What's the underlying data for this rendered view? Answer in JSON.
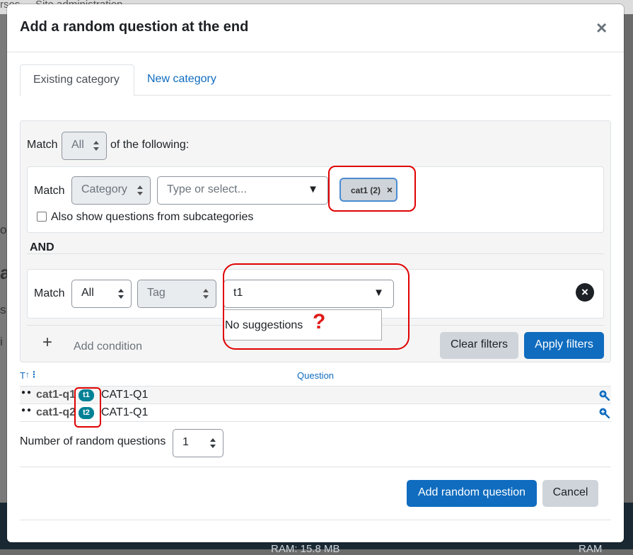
{
  "background": {
    "topbar_left": "rses",
    "topbar_nav": "Site administration",
    "left_fragments": [
      "o",
      "a",
      "s",
      "i"
    ],
    "bottom_left": "RAM: 15.8 MB",
    "bottom_right": "RAM"
  },
  "modal": {
    "title": "Add a random question at the end",
    "close_symbol": "×"
  },
  "tabs": [
    {
      "label": "Existing category",
      "active": true
    },
    {
      "label": "New category",
      "active": false
    }
  ],
  "filter": {
    "match_label": "Match",
    "match_value": "All",
    "of_following": "of the following:",
    "condition1": {
      "match_label": "Match",
      "type_value": "Category",
      "input_placeholder": "Type or select...",
      "chip_label": "cat1 (2)",
      "chip_remove": "×",
      "subcat_label": "Also show questions from subcategories"
    },
    "and_label": "AND",
    "condition2": {
      "match_label": "Match",
      "match_value": "All",
      "type_value": "Tag",
      "input_value": "t1",
      "no_suggestions": "No suggestions",
      "question_mark": "?",
      "remove_symbol": "×"
    },
    "add_condition_symbol": "+",
    "add_condition_label": "Add condition",
    "clear_label": "Clear filters",
    "apply_label": "Apply filters"
  },
  "table": {
    "type_header": "T",
    "question_header": "Question",
    "rows": [
      {
        "name": "cat1-q1",
        "tag": "t1",
        "text": "CAT1-Q1"
      },
      {
        "name": "cat1-q2",
        "tag": "t2",
        "text": "CAT1-Q1"
      }
    ]
  },
  "number": {
    "label": "Number of random questions",
    "value": "1"
  },
  "footer": {
    "add_label": "Add random question",
    "cancel_label": "Cancel"
  },
  "colors": {
    "primary": "#0f6cbf",
    "tag_badge": "#008196",
    "highlight": "#e00000"
  }
}
